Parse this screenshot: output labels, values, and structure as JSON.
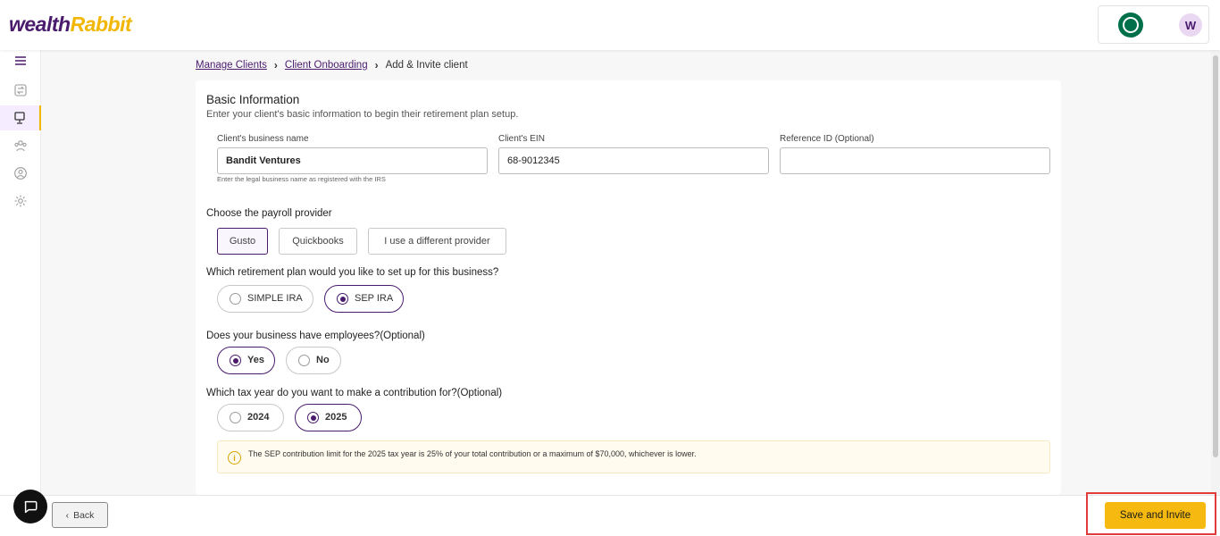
{
  "header": {
    "logo_part1": "wealth",
    "logo_part2": "Rabbit",
    "brand_icon": "starbucks-logo",
    "avatar_initial": "W"
  },
  "sidebar": {
    "items": [
      {
        "icon": "menu-icon"
      },
      {
        "icon": "transfer-icon"
      },
      {
        "icon": "monitor-icon",
        "active": true
      },
      {
        "icon": "people-group-icon"
      },
      {
        "icon": "user-circle-icon"
      },
      {
        "icon": "gear-icon"
      }
    ]
  },
  "breadcrumb": {
    "item1": "Manage Clients",
    "item2": "Client Onboarding",
    "current": "Add & Invite client"
  },
  "basic_info": {
    "title": "Basic Information",
    "subtitle": "Enter your client's basic information to begin their retirement plan setup.",
    "business_name_label": "Client's business name",
    "business_name_value": "Bandit Ventures",
    "business_name_hint": "Enter the legal business name as registered with the IRS",
    "ein_label": "Client's EIN",
    "ein_value": "68-9012345",
    "reference_label": "Reference ID (Optional)",
    "reference_value": ""
  },
  "payroll": {
    "label": "Choose the payroll provider",
    "options": [
      "Gusto",
      "Quickbooks",
      "I use a different provider"
    ],
    "selected": "Gusto"
  },
  "plan": {
    "label": "Which retirement plan would you like to set up for this business?",
    "options": [
      "SIMPLE IRA",
      "SEP IRA"
    ],
    "selected": "SEP IRA"
  },
  "employees": {
    "label": "Does your business have employees?(Optional)",
    "options": [
      "Yes",
      "No"
    ],
    "selected": "Yes"
  },
  "tax_year": {
    "label": "Which tax year do you want to make a contribution for?(Optional)",
    "options": [
      "2024",
      "2025"
    ],
    "selected": "2025"
  },
  "notice": {
    "icon": "info-icon",
    "text": "The SEP contribution limit for the 2025 tax year is 25% of your total contribution or a maximum of $70,000, whichever is lower."
  },
  "footer": {
    "back_label": "Back",
    "save_label": "Save and Invite",
    "chat_icon": "chat-bubble-icon"
  },
  "colors": {
    "brand_purple": "#4a1b6d",
    "brand_yellow": "#f5b90f",
    "highlight_red": "#e23b3b"
  }
}
